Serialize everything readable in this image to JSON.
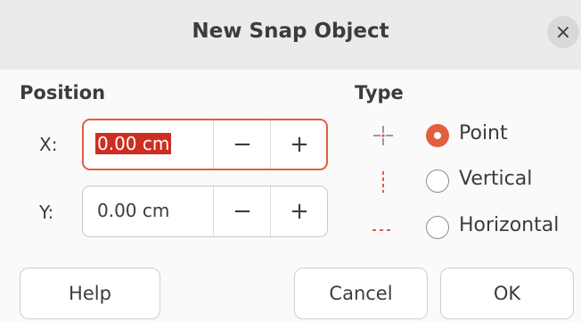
{
  "dialog": {
    "title": "New Snap Object",
    "close_glyph": "×"
  },
  "position": {
    "heading": "Position",
    "x": {
      "label": "X:",
      "value": "0.00 cm",
      "minus": "−",
      "plus": "+"
    },
    "y": {
      "label": "Y:",
      "value": "0.00 cm",
      "minus": "−",
      "plus": "+"
    }
  },
  "type": {
    "heading": "Type",
    "options": [
      {
        "label": "Point",
        "checked": true,
        "icon": "snap-point-icon"
      },
      {
        "label": "Vertical",
        "checked": false,
        "icon": "snap-vertical-icon"
      },
      {
        "label": "Horizontal",
        "checked": false,
        "icon": "snap-horizontal-icon"
      }
    ]
  },
  "buttons": {
    "help": "Help",
    "cancel": "Cancel",
    "ok": "OK"
  },
  "colors": {
    "accent": "#e35e3f",
    "selection": "#cd2e20",
    "titlebar": "#ebebeb"
  }
}
